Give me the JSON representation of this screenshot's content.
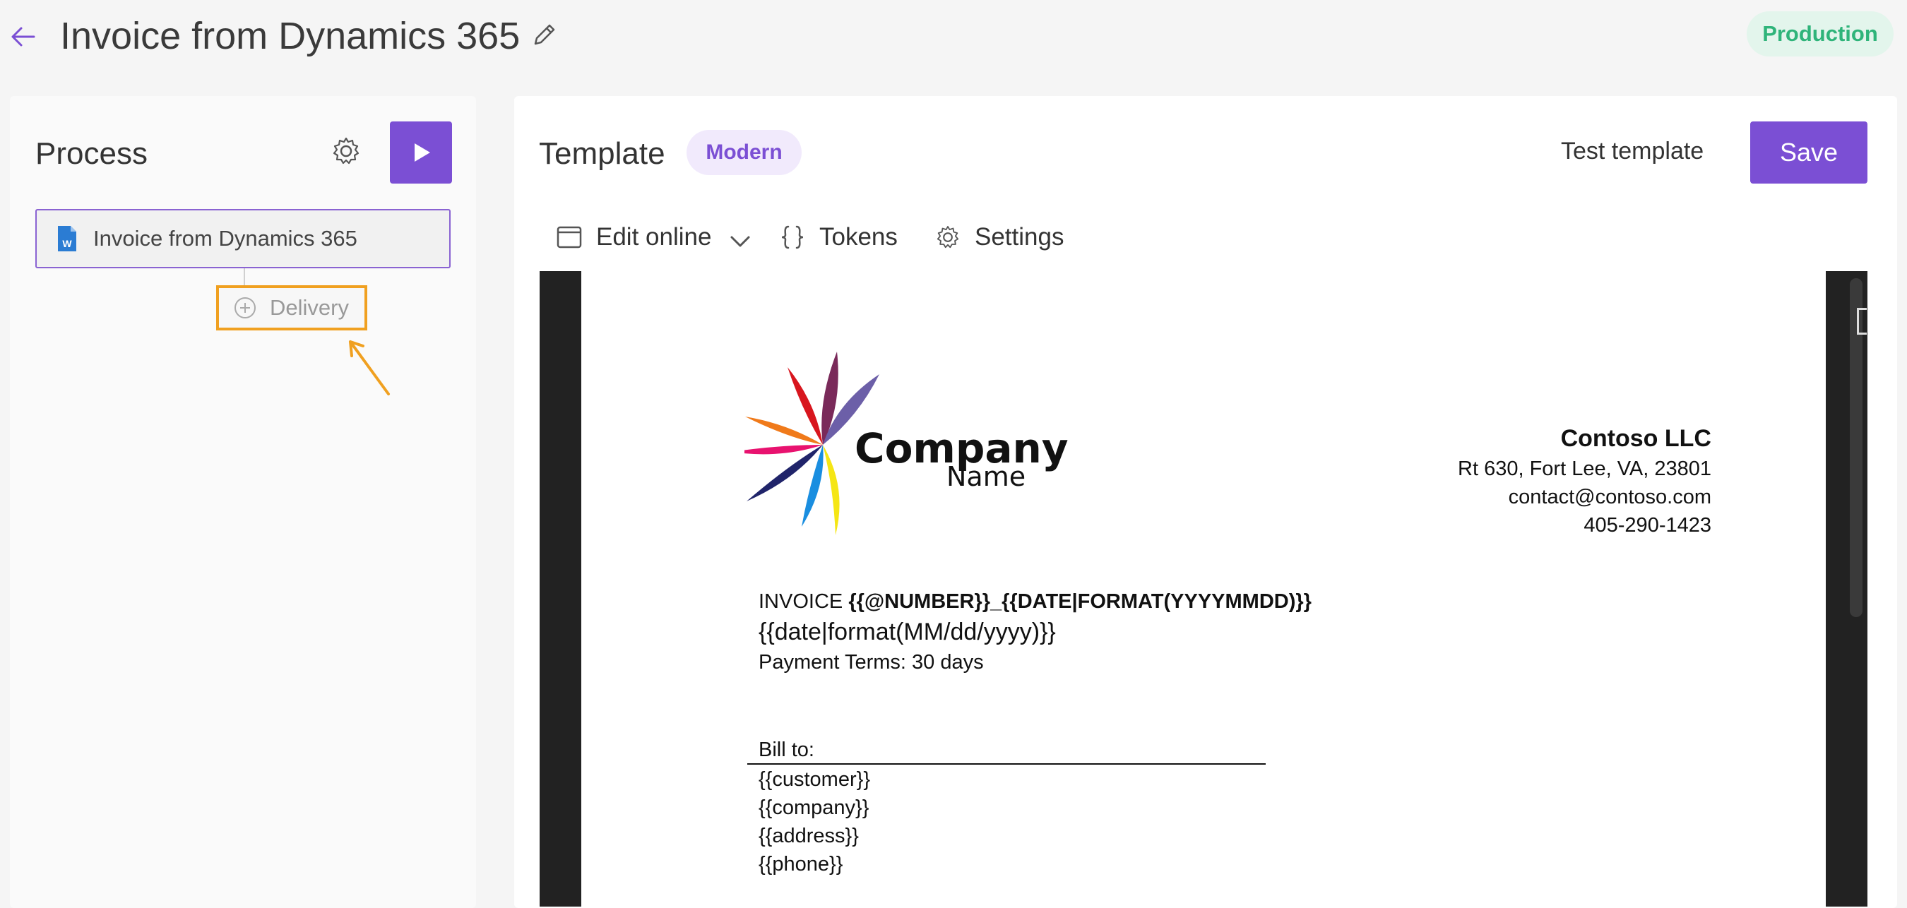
{
  "header": {
    "title": "Invoice from Dynamics 365",
    "environment_badge": "Production"
  },
  "process": {
    "title": "Process",
    "item_label": "Invoice from Dynamics 365",
    "delivery_label": "Delivery"
  },
  "template": {
    "title": "Template",
    "style_badge": "Modern",
    "test_button": "Test template",
    "save_button": "Save"
  },
  "toolbar": {
    "edit_online": "Edit online",
    "tokens": "Tokens",
    "settings": "Settings"
  },
  "document": {
    "logo_company": "Company",
    "logo_name": "Name",
    "company_name": "Contoso LLC",
    "company_address": "Rt 630, Fort Lee, VA, 23801",
    "company_email": "contact@contoso.com",
    "company_phone": "405-290-1423",
    "invoice_prefix": "INVOICE ",
    "invoice_number_token": "{{@NUMBER}}_{{DATE|FORMAT(YYYYMMDD)}}",
    "invoice_date_token": "{{date|format(MM/dd/yyyy)}}",
    "payment_terms": "Payment Terms: 30 days",
    "bill_to_label": "Bill to:",
    "bill_to_fields": [
      "{{customer}}",
      "{{company}}",
      "{{address}}",
      "{{phone}}"
    ]
  },
  "colors": {
    "accent": "#7b4fd4",
    "production_badge_bg": "#e3f5ec",
    "production_badge_text": "#2fb47a",
    "highlight_box": "#f0a020"
  },
  "icons": [
    "back-arrow-icon",
    "pencil-icon",
    "gear-icon",
    "play-icon",
    "word-doc-icon",
    "plus-circle-icon",
    "window-icon",
    "chevron-down-icon",
    "braces-icon"
  ]
}
